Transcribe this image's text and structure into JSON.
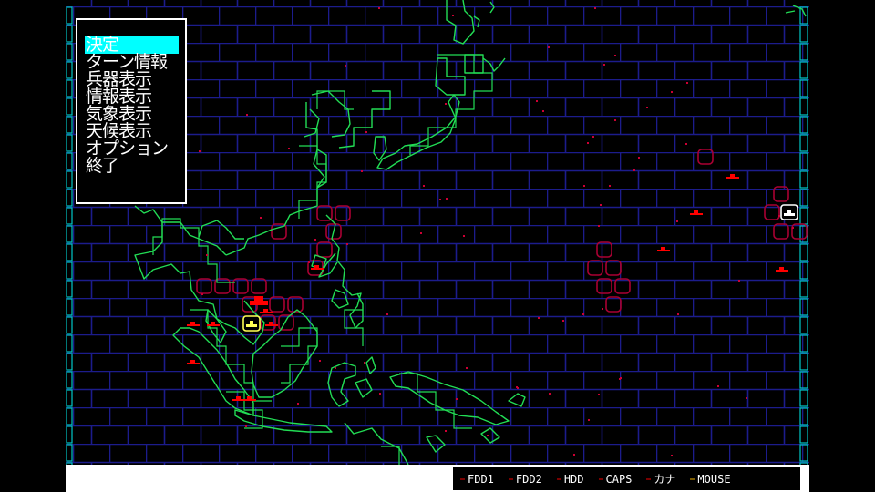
{
  "menu": {
    "items": [
      {
        "label": "決定",
        "selected": true
      },
      {
        "label": "ターン情報",
        "selected": false
      },
      {
        "label": "兵器表示",
        "selected": false
      },
      {
        "label": "情報表示",
        "selected": false
      },
      {
        "label": "気象表示",
        "selected": false
      },
      {
        "label": "天候表示",
        "selected": false
      },
      {
        "label": "オプション",
        "selected": false
      },
      {
        "label": "終了",
        "selected": false
      }
    ]
  },
  "status": {
    "indicators": [
      "FDD1",
      "FDD2",
      "HDD",
      "CAPS",
      "カナ",
      "MOUSE"
    ]
  },
  "colors": {
    "grid": "#1c1c8c",
    "border_cells": "#00c8c8",
    "coastline": "#22dd55",
    "enemy": "#ff0000",
    "zone": "#aa0033",
    "menu_highlight": "#00ffff",
    "player_unit": "#ffffff",
    "selected_unit": "#ffff55"
  }
}
